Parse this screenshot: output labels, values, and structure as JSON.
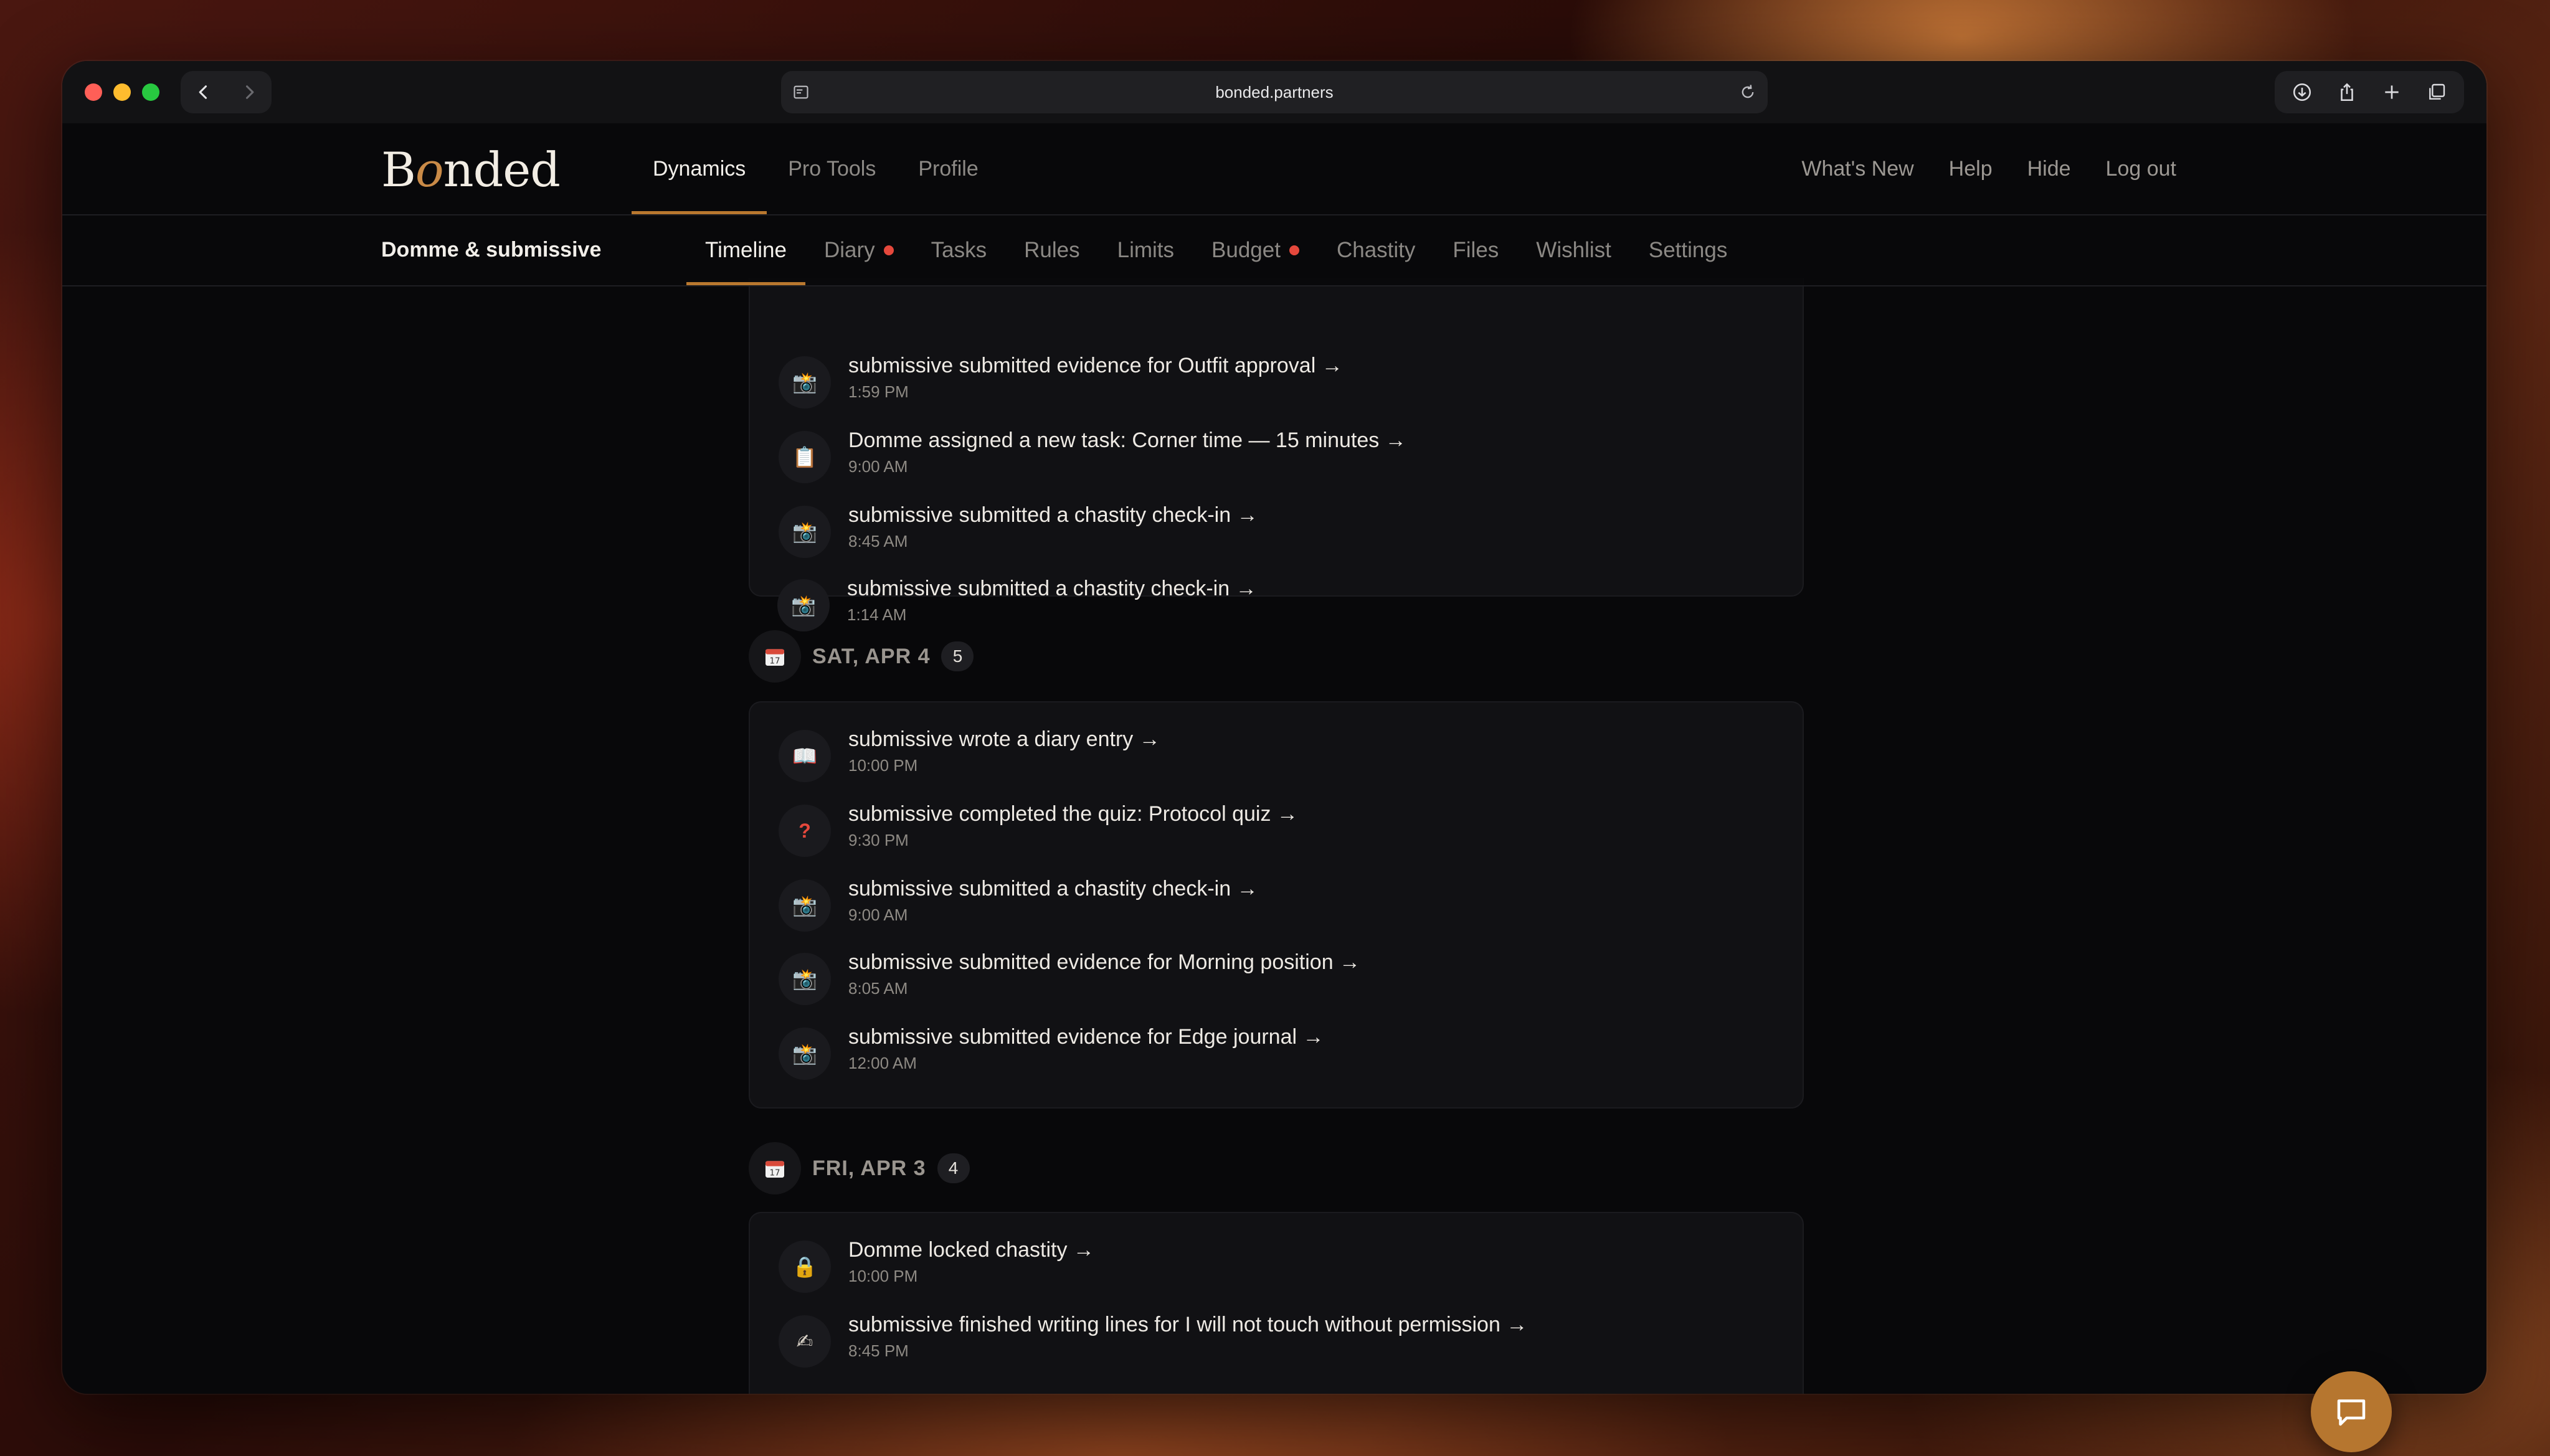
{
  "browser": {
    "url": "bonded.partners"
  },
  "brand": {
    "pre": "B",
    "o": "o",
    "post": "nded"
  },
  "top_nav": [
    {
      "label": "Dynamics",
      "active": true
    },
    {
      "label": "Pro Tools"
    },
    {
      "label": "Profile"
    }
  ],
  "top_right": [
    "What's New",
    "Help",
    "Hide",
    "Log out"
  ],
  "dynamic_name": "Domme & submissive",
  "sub_nav": [
    {
      "label": "Timeline",
      "active": true
    },
    {
      "label": "Diary",
      "dot": true
    },
    {
      "label": "Tasks"
    },
    {
      "label": "Rules"
    },
    {
      "label": "Limits"
    },
    {
      "label": "Budget",
      "dot": true
    },
    {
      "label": "Chastity"
    },
    {
      "label": "Files"
    },
    {
      "label": "Wishlist"
    },
    {
      "label": "Settings"
    }
  ],
  "timeline": {
    "group_top": {
      "events": [
        {
          "icon": "📸",
          "icon_name": "camera-flash-icon",
          "title": "submissive submitted evidence for Outfit approval →",
          "time": "1:59 PM"
        },
        {
          "icon": "📋",
          "icon_name": "clipboard-icon",
          "title": "Domme assigned a new task: Corner time — 15 minutes →",
          "time": "9:00 AM"
        },
        {
          "icon": "📸",
          "icon_name": "camera-flash-icon",
          "title": "submissive submitted a chastity check-in →",
          "time": "8:45 AM"
        },
        {
          "icon": "📸",
          "icon_name": "camera-flash-icon",
          "title": "submissive submitted a chastity check-in →",
          "time": "1:14 AM"
        }
      ]
    },
    "day_sat": {
      "label": "SAT, APR 4",
      "count": "5",
      "events": [
        {
          "icon": "📖",
          "icon_name": "book-icon",
          "title": "submissive wrote a diary entry →",
          "time": "10:00 PM"
        },
        {
          "icon": "?",
          "icon_name": "question-mark-icon",
          "title": "submissive completed the quiz: Protocol quiz →",
          "time": "9:30 PM"
        },
        {
          "icon": "📸",
          "icon_name": "camera-flash-icon",
          "title": "submissive submitted a chastity check-in →",
          "time": "9:00 AM"
        },
        {
          "icon": "📸",
          "icon_name": "camera-flash-icon",
          "title": "submissive submitted evidence for Morning position →",
          "time": "8:05 AM"
        },
        {
          "icon": "📸",
          "icon_name": "camera-flash-icon",
          "title": "submissive submitted evidence for Edge journal →",
          "time": "12:00 AM"
        }
      ]
    },
    "day_fri": {
      "label": "FRI, APR 3",
      "count": "4",
      "events": [
        {
          "icon": "🔒",
          "icon_name": "lock-icon",
          "title": "Domme locked chastity →",
          "time": "10:00 PM"
        },
        {
          "icon": "✍",
          "icon_name": "writing-hand-icon",
          "title": "submissive finished writing lines for I will not touch without permission →",
          "time": "8:45 PM"
        }
      ]
    }
  },
  "colors": {
    "accent": "#b9782f",
    "notification_dot": "#e5483c"
  }
}
